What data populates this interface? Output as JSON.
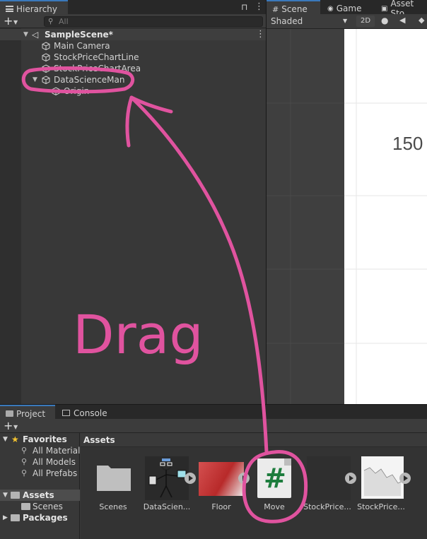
{
  "hierarchy": {
    "tab_label": "Hierarchy",
    "search_placeholder": "All",
    "scene_name": "SampleScene*",
    "items": [
      {
        "label": "Main Camera"
      },
      {
        "label": "StockPriceChartLine"
      },
      {
        "label": "StockPriceChartArea"
      },
      {
        "label": "DataScienceMan"
      },
      {
        "label": "Origin"
      }
    ]
  },
  "scene": {
    "tabs": [
      {
        "label": "Scene"
      },
      {
        "label": "Game"
      },
      {
        "label": "Asset Sto"
      }
    ],
    "shading_mode": "Shaded",
    "mode_2d": "2D",
    "axis_value": "150"
  },
  "project": {
    "tabs": [
      {
        "label": "Project"
      },
      {
        "label": "Console"
      }
    ],
    "breadcrumb": "Assets",
    "sidebar": {
      "favorites_label": "Favorites",
      "favorites": [
        {
          "label": "All Materials"
        },
        {
          "label": "All Models"
        },
        {
          "label": "All Prefabs"
        }
      ],
      "assets_label": "Assets",
      "assets_children": [
        {
          "label": "Scenes"
        }
      ],
      "packages_label": "Packages"
    },
    "assets": [
      {
        "label": "Scenes"
      },
      {
        "label": "DataScien..."
      },
      {
        "label": "Floor"
      },
      {
        "label": "Move"
      },
      {
        "label": "StockPrice..."
      },
      {
        "label": "StockPrice..."
      }
    ]
  },
  "annotation": {
    "text": "Drag",
    "color": "#e0539f"
  },
  "colors": {
    "highlight_pink": "#e0539f",
    "editor_bg": "#383838",
    "tab_accent": "#3a79bb"
  }
}
